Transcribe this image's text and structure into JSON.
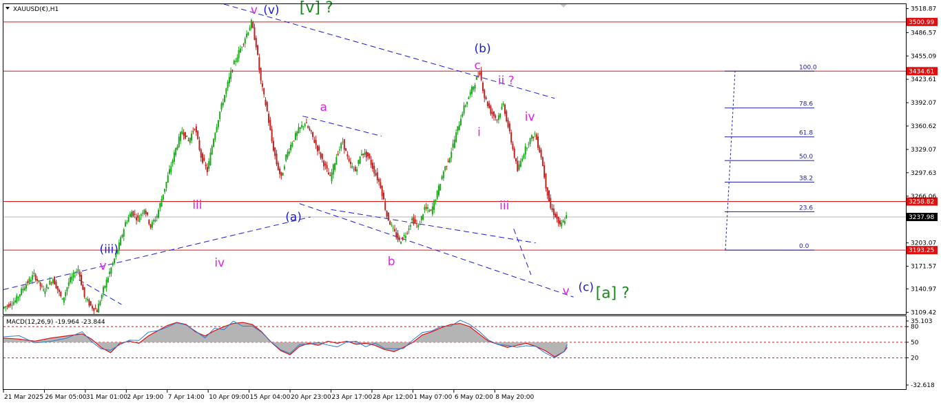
{
  "chart_data": [
    {
      "type": "candlestick",
      "symbol_label": "XAUUSD(€),H1",
      "price_ticks": [
        "3518.87",
        "3486.57",
        "3455.09",
        "3423.61",
        "3392.07",
        "3360.62",
        "3329.07",
        "3297.63",
        "3266.06",
        "3203.07",
        "3171.57",
        "3140.97",
        "3109.42"
      ],
      "price_tick_values": [
        3518.87,
        3486.57,
        3455.09,
        3423.61,
        3392.07,
        3360.62,
        3329.07,
        3297.63,
        3266.06,
        3203.07,
        3171.57,
        3140.97,
        3109.42
      ],
      "ylim": [
        3107,
        3525
      ],
      "horizontal_levels": [
        {
          "label": "3500.99",
          "value": 3500.99,
          "color": "#e01010"
        },
        {
          "label": "3434.61",
          "value": 3434.61,
          "color": "#e01010"
        },
        {
          "label": "3258.82",
          "value": 3258.82,
          "color": "#e01010"
        },
        {
          "label": "3193.25",
          "value": 3193.25,
          "color": "#e01010"
        }
      ],
      "current_price": {
        "label": "3237.98",
        "value": 3237.98
      },
      "fibonacci": [
        {
          "label": "100.0",
          "value": 3434.61
        },
        {
          "label": "78.6",
          "value": 3385.0
        },
        {
          "label": "61.8",
          "value": 3346.0
        },
        {
          "label": "50.0",
          "value": 3314.0
        },
        {
          "label": "38.2",
          "value": 3285.0
        },
        {
          "label": "23.6",
          "value": 3245.0
        },
        {
          "label": "0.0",
          "value": 3193.25
        }
      ],
      "path_points": [
        [
          0,
          3115
        ],
        [
          8,
          3125
        ],
        [
          14,
          3145
        ],
        [
          20,
          3160
        ],
        [
          26,
          3138
        ],
        [
          32,
          3155
        ],
        [
          38,
          3125
        ],
        [
          42,
          3150
        ],
        [
          48,
          3168
        ],
        [
          52,
          3130
        ],
        [
          56,
          3118
        ],
        [
          60,
          3112
        ],
        [
          64,
          3140
        ],
        [
          70,
          3175
        ],
        [
          74,
          3200
        ],
        [
          78,
          3230
        ],
        [
          82,
          3245
        ],
        [
          86,
          3235
        ],
        [
          90,
          3250
        ],
        [
          94,
          3225
        ],
        [
          98,
          3240
        ],
        [
          102,
          3270
        ],
        [
          106,
          3300
        ],
        [
          110,
          3330
        ],
        [
          114,
          3355
        ],
        [
          118,
          3340
        ],
        [
          122,
          3360
        ],
        [
          126,
          3320
        ],
        [
          130,
          3300
        ],
        [
          134,
          3345
        ],
        [
          138,
          3380
        ],
        [
          142,
          3410
        ],
        [
          146,
          3440
        ],
        [
          150,
          3460
        ],
        [
          154,
          3480
        ],
        [
          158,
          3500
        ],
        [
          161,
          3470
        ],
        [
          164,
          3420
        ],
        [
          168,
          3380
        ],
        [
          171,
          3340
        ],
        [
          174,
          3310
        ],
        [
          177,
          3290
        ],
        [
          180,
          3320
        ],
        [
          184,
          3340
        ],
        [
          188,
          3355
        ],
        [
          192,
          3365
        ],
        [
          196,
          3350
        ],
        [
          200,
          3330
        ],
        [
          204,
          3310
        ],
        [
          208,
          3290
        ],
        [
          212,
          3320
        ],
        [
          216,
          3340
        ],
        [
          220,
          3310
        ],
        [
          224,
          3300
        ],
        [
          228,
          3325
        ],
        [
          232,
          3320
        ],
        [
          236,
          3300
        ],
        [
          240,
          3280
        ],
        [
          244,
          3240
        ],
        [
          248,
          3220
        ],
        [
          252,
          3205
        ],
        [
          256,
          3215
        ],
        [
          260,
          3235
        ],
        [
          264,
          3225
        ],
        [
          268,
          3250
        ],
        [
          272,
          3245
        ],
        [
          276,
          3270
        ],
        [
          280,
          3300
        ],
        [
          284,
          3320
        ],
        [
          288,
          3350
        ],
        [
          292,
          3380
        ],
        [
          296,
          3400
        ],
        [
          300,
          3420
        ],
        [
          303,
          3434
        ],
        [
          306,
          3400
        ],
        [
          310,
          3380
        ],
        [
          314,
          3370
        ],
        [
          318,
          3390
        ],
        [
          321,
          3360
        ],
        [
          324,
          3330
        ],
        [
          327,
          3300
        ],
        [
          330,
          3320
        ],
        [
          334,
          3340
        ],
        [
          338,
          3350
        ],
        [
          342,
          3320
        ],
        [
          345,
          3280
        ],
        [
          348,
          3250
        ],
        [
          351,
          3240
        ],
        [
          354,
          3225
        ],
        [
          358,
          3238
        ]
      ],
      "x_ticks": [
        "21 Mar 2025",
        "26 Mar 05:00",
        "31 Mar 01:00",
        "2 Apr 19:00",
        "7 Apr 14:00",
        "10 Apr 09:00",
        "15 Apr 04:00",
        "20 Apr 23:00",
        "23 Apr 17:00",
        "28 Apr 12:00",
        "1 May 07:00",
        "6 May 02:00",
        "8 May 20:00"
      ],
      "x_tick_index": [
        0,
        26,
        52,
        78,
        104,
        130,
        156,
        182,
        208,
        234,
        260,
        286,
        312
      ],
      "x_total": 360,
      "wave_labels": [
        {
          "text": "v",
          "color": "#e020e0",
          "size": 17,
          "i": 157,
          "p": 3512
        },
        {
          "text": "(v)",
          "color": "#1a1adc",
          "size": 17,
          "i": 165,
          "p": 3512
        },
        {
          "text": "[v] ?",
          "color": "#1a8a1a",
          "size": 22,
          "i": 188,
          "p": 3514
        },
        {
          "text": "(b)",
          "color": "#1a1adc",
          "size": 17,
          "i": 299,
          "p": 3460
        },
        {
          "text": "c",
          "color": "#e020e0",
          "size": 17,
          "i": 299,
          "p": 3437
        },
        {
          "text": "ii ?",
          "color": "#e020e0",
          "size": 17,
          "i": 314,
          "p": 3417
        },
        {
          "text": "iv",
          "color": "#e020e0",
          "size": 17,
          "i": 331,
          "p": 3368
        },
        {
          "text": "i",
          "color": "#e020e0",
          "size": 17,
          "i": 301,
          "p": 3347
        },
        {
          "text": "a",
          "color": "#e020e0",
          "size": 17,
          "i": 201,
          "p": 3381
        },
        {
          "text": "iii",
          "color": "#e020e0",
          "size": 17,
          "i": 120,
          "p": 3249
        },
        {
          "text": "iii",
          "color": "#e020e0",
          "size": 17,
          "i": 315,
          "p": 3248
        },
        {
          "text": "(a)",
          "color": "#1a1adc",
          "size": 17,
          "i": 179,
          "p": 3233
        },
        {
          "text": "iv",
          "color": "#e020e0",
          "size": 17,
          "i": 134,
          "p": 3171
        },
        {
          "text": "b",
          "color": "#e020e0",
          "size": 17,
          "i": 244,
          "p": 3173
        },
        {
          "text": "(iii)",
          "color": "#1a1adc",
          "size": 17,
          "i": 61,
          "p": 3189
        },
        {
          "text": "v",
          "color": "#e020e0",
          "size": 17,
          "i": 61,
          "p": 3167
        },
        {
          "text": "v",
          "color": "#e020e0",
          "size": 17,
          "i": 355,
          "p": 3133
        },
        {
          "text": "(c)",
          "color": "#1a1adc",
          "size": 17,
          "i": 365,
          "p": 3138
        },
        {
          "text": "[a] ?",
          "color": "#1a8a1a",
          "size": 22,
          "i": 376,
          "p": 3129
        }
      ]
    },
    {
      "type": "macd",
      "label": "MACD(12,26,9) -19.964 -23.844",
      "ticks": [
        "35.103",
        "80",
        "50",
        "20",
        "-32.618"
      ],
      "tick_values": [
        35.103,
        80,
        50,
        20,
        -32.618
      ],
      "levels": [
        80,
        50,
        20
      ],
      "signal_color": "#e01010",
      "main_color": "#2a7ad8",
      "histogram_color": "#b4b4b4",
      "histogram": [
        [
          0,
          58
        ],
        [
          10,
          56
        ],
        [
          20,
          52
        ],
        [
          30,
          58
        ],
        [
          40,
          62
        ],
        [
          50,
          66
        ],
        [
          56,
          56
        ],
        [
          62,
          40
        ],
        [
          68,
          30
        ],
        [
          74,
          48
        ],
        [
          80,
          52
        ],
        [
          86,
          48
        ],
        [
          92,
          62
        ],
        [
          98,
          72
        ],
        [
          104,
          82
        ],
        [
          110,
          88
        ],
        [
          116,
          84
        ],
        [
          122,
          70
        ],
        [
          128,
          62
        ],
        [
          134,
          72
        ],
        [
          140,
          80
        ],
        [
          146,
          86
        ],
        [
          152,
          88
        ],
        [
          158,
          84
        ],
        [
          164,
          70
        ],
        [
          170,
          50
        ],
        [
          176,
          34
        ],
        [
          182,
          26
        ],
        [
          188,
          42
        ],
        [
          194,
          48
        ],
        [
          200,
          44
        ],
        [
          206,
          52
        ],
        [
          212,
          48
        ],
        [
          218,
          52
        ],
        [
          224,
          46
        ],
        [
          230,
          48
        ],
        [
          236,
          44
        ],
        [
          242,
          36
        ],
        [
          248,
          32
        ],
        [
          254,
          40
        ],
        [
          260,
          50
        ],
        [
          266,
          64
        ],
        [
          272,
          70
        ],
        [
          278,
          78
        ],
        [
          284,
          84
        ],
        [
          290,
          86
        ],
        [
          296,
          80
        ],
        [
          302,
          66
        ],
        [
          308,
          52
        ],
        [
          314,
          46
        ],
        [
          320,
          40
        ],
        [
          326,
          44
        ],
        [
          332,
          48
        ],
        [
          338,
          42
        ],
        [
          344,
          34
        ],
        [
          350,
          22
        ],
        [
          356,
          32
        ],
        [
          358,
          40
        ]
      ]
    }
  ]
}
